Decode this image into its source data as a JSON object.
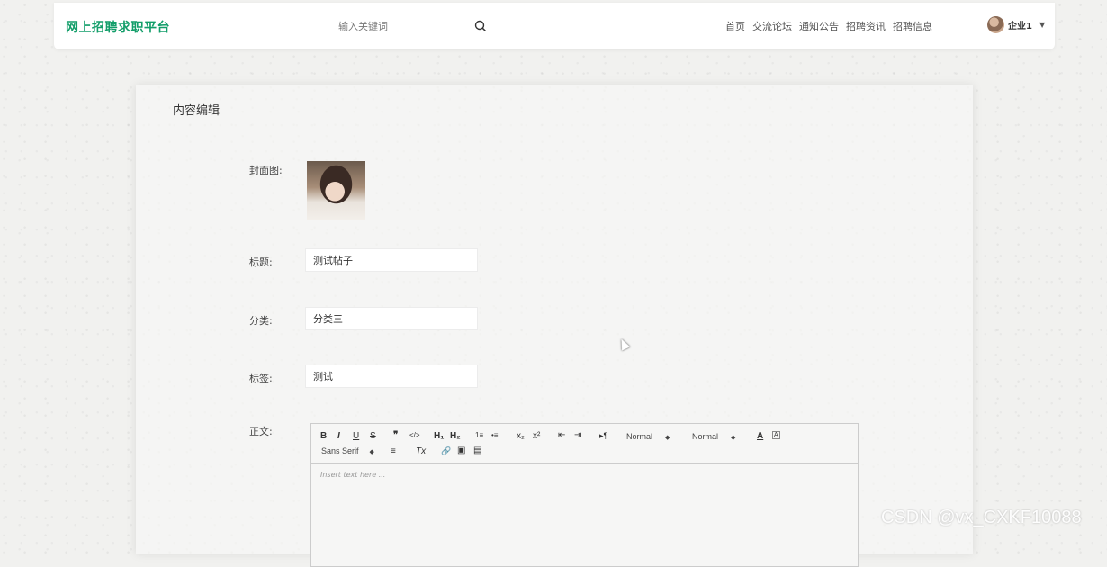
{
  "header": {
    "brand": "网上招聘求职平台",
    "search": {
      "placeholder": "输入关键词",
      "value": ""
    },
    "nav": [
      "首页",
      "交流论坛",
      "通知公告",
      "招聘资讯",
      "招聘信息"
    ],
    "user": {
      "name": "企业1"
    }
  },
  "form": {
    "title": "内容编辑",
    "cover_label": "封面图:",
    "title_label": "标题:",
    "title_value": "测试帖子",
    "category_label": "分类:",
    "category_value": "分类三",
    "tag_label": "标签:",
    "tag_value": "测试",
    "content_label": "正文:"
  },
  "editor": {
    "toolbar": {
      "bold": "B",
      "italic": "I",
      "underline": "U",
      "strike": "S",
      "quote": "❞",
      "code": "</>",
      "h1": "H₁",
      "h2": "H₂",
      "ordered_list": "1≡",
      "bullet_list": "•≡",
      "subscript": "x₂",
      "superscript": "x²",
      "outdent": "⇤",
      "indent": "⇥",
      "direction": "▸¶",
      "size": "Normal",
      "header": "Normal",
      "font": "Sans Serif",
      "color": "A",
      "background": "A",
      "align": "≡",
      "clean": "Tx",
      "link": "🔗",
      "image": "▣",
      "video": "▤"
    },
    "placeholder": "Insert text here ..."
  },
  "watermark": "CSDN @vx_CXKF10088",
  "colors": {
    "brand": "#139e6a"
  }
}
